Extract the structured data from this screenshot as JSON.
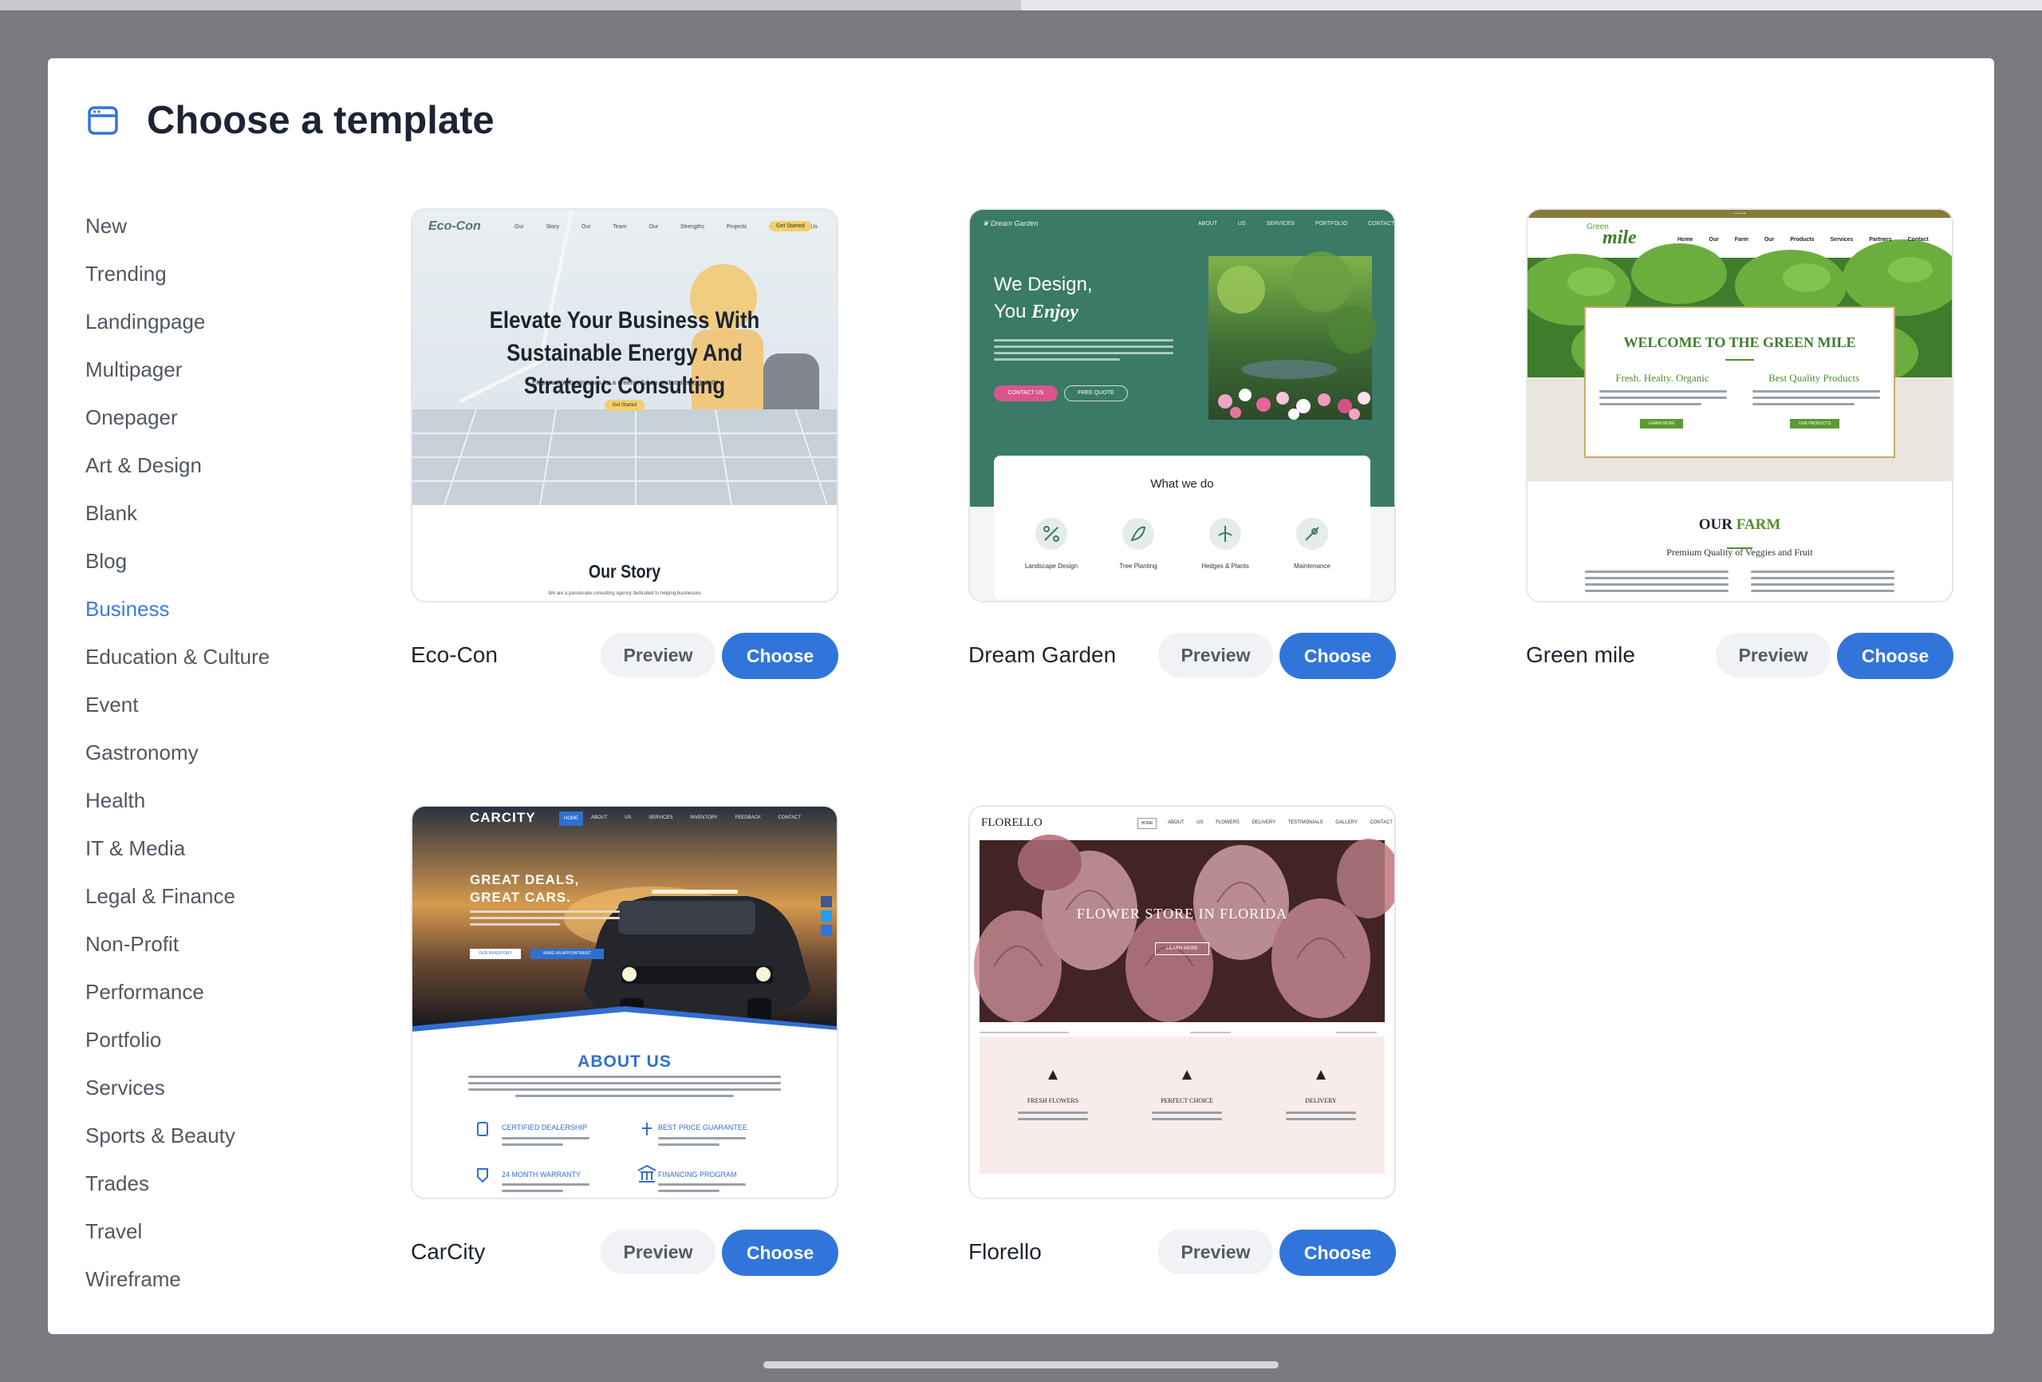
{
  "modal": {
    "title": "Choose a template",
    "icon": "browser-window-icon"
  },
  "categories": [
    {
      "label": "New",
      "active": false
    },
    {
      "label": "Trending",
      "active": false
    },
    {
      "label": "Landingpage",
      "active": false
    },
    {
      "label": "Multipager",
      "active": false
    },
    {
      "label": "Onepager",
      "active": false
    },
    {
      "label": "Art & Design",
      "active": false
    },
    {
      "label": "Blank",
      "active": false
    },
    {
      "label": "Blog",
      "active": false
    },
    {
      "label": "Business",
      "active": true
    },
    {
      "label": "Education & Culture",
      "active": false
    },
    {
      "label": "Event",
      "active": false
    },
    {
      "label": "Gastronomy",
      "active": false
    },
    {
      "label": "Health",
      "active": false
    },
    {
      "label": "IT & Media",
      "active": false
    },
    {
      "label": "Legal & Finance",
      "active": false
    },
    {
      "label": "Non-Profit",
      "active": false
    },
    {
      "label": "Performance",
      "active": false
    },
    {
      "label": "Portfolio",
      "active": false
    },
    {
      "label": "Services",
      "active": false
    },
    {
      "label": "Sports & Beauty",
      "active": false
    },
    {
      "label": "Trades",
      "active": false
    },
    {
      "label": "Travel",
      "active": false
    },
    {
      "label": "Wireframe",
      "active": false
    }
  ],
  "buttons": {
    "preview": "Preview",
    "choose": "Choose"
  },
  "templates": [
    {
      "name": "Eco-Con",
      "thumb": {
        "logo": "Eco-Con",
        "nav": [
          "Our Story",
          "Our Team",
          "Our Strengths",
          "Projects",
          "Contact Us"
        ],
        "cta": "Get Started",
        "headline": "Elevate Your Business With Sustainable Energy And Strategic Consulting",
        "sub": "Empowering businesses for a greener future and strategic growth",
        "button": "Get Started",
        "section": "Our Story",
        "section_text": "We are a passionate consulting agency dedicated to helping businesses"
      }
    },
    {
      "name": "Dream Garden",
      "thumb": {
        "logo": "Dream Garden",
        "nav": [
          "ABOUT US",
          "SERVICES",
          "PORTFOLIO",
          "CONTACT"
        ],
        "headline_1": "We Design,",
        "headline_2": "You ",
        "headline_em": "Enjoy",
        "btn_1": "CONTACT US",
        "btn_2": "FREE QUOTE",
        "box_title": "What we do",
        "services": [
          "Landscape Design",
          "Tree Planting",
          "Hedges & Plants",
          "Maintenance"
        ]
      }
    },
    {
      "name": "Green mile",
      "thumb": {
        "logo_top": "Green",
        "logo_main": "mile",
        "nav": [
          "Home",
          "Our Farm",
          "Our Products",
          "Services",
          "Partners",
          "Contact"
        ],
        "welcome": "WELCOME TO THE GREEN MILE",
        "col_1": "Fresh. Healty. Organic",
        "col_2": "Best Quality Products",
        "btn_1": "LEARN MORE",
        "btn_2": "OUR PRODUCTS",
        "section_a": "OUR ",
        "section_b": "FARM",
        "section_sub": "Premium Quality of Veggies and Fruit"
      }
    },
    {
      "name": "CarCity",
      "thumb": {
        "logo": "CARCITY",
        "nav": [
          "HOME",
          "ABOUT US",
          "SERVICES",
          "INVENTORY",
          "FEEDBACK",
          "CONTACT"
        ],
        "headline_1": "GREAT DEALS,",
        "headline_2": "GREAT CARS.",
        "btn_1": "OUR INVENTORY",
        "btn_2": "MAKE AN APPOINTMENT",
        "section": "ABOUT US",
        "features": [
          "CERTIFIED DEALERSHIP",
          "BEST PRICE GUARANTEE",
          "24 MONTH WARRANTY",
          "FINANCING PROGRAM"
        ]
      }
    },
    {
      "name": "Florello",
      "thumb": {
        "logo": "FLORELLO",
        "nav": [
          "HOME",
          "ABOUT US",
          "FLOWERS",
          "DELIVERY",
          "TESTIMONIALS",
          "GALLERY",
          "CONTACT"
        ],
        "headline": "FLOWER STORE IN FLORIDA",
        "button": "LEARN MORE",
        "features": [
          "FRESH FLOWERS",
          "PERFECT CHOICE",
          "DELIVERY"
        ]
      }
    }
  ],
  "colors": {
    "accent": "#3175db",
    "active_category": "#3b7be1",
    "title": "#1c2434",
    "backdrop": "#7a7b80"
  }
}
